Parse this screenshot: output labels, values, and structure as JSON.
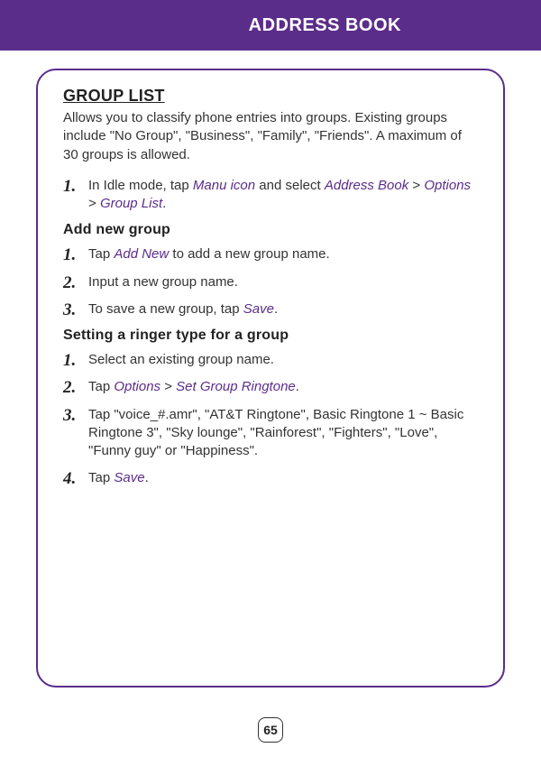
{
  "header": {
    "title": "ADDRESS BOOK"
  },
  "section": {
    "title": "GROUP LIST",
    "intro": "Allows you to classify phone entries into groups. Existing groups include \"No Group\", \"Business\", \"Family\", \"Friends\". A maximum of 30 groups is allowed."
  },
  "top_steps": {
    "items": [
      {
        "num": "1.",
        "prefix": "In Idle mode, tap ",
        "term1": "Manu icon",
        "mid1": " and select ",
        "term2": "Address Book",
        "gt1": " > ",
        "term3": "Options",
        "gt2": " > ",
        "term4": "Group List",
        "suffix": "."
      }
    ]
  },
  "add_new": {
    "heading": "Add new group",
    "items": [
      {
        "num": "1.",
        "prefix": "Tap ",
        "term1": "Add New",
        "suffix": " to add a new group name."
      },
      {
        "num": "2.",
        "text": "Input a new group name."
      },
      {
        "num": "3.",
        "prefix": "To save a new group, tap ",
        "term1": "Save",
        "suffix": "."
      }
    ]
  },
  "ringer": {
    "heading": "Setting a ringer type for a group",
    "items": [
      {
        "num": "1.",
        "text": "Select an existing group name."
      },
      {
        "num": "2.",
        "prefix": "Tap ",
        "term1": "Options",
        "gt1": " > ",
        "term2": "Set Group Ringtone",
        "suffix": "."
      },
      {
        "num": "3.",
        "text": "Tap \"voice_#.amr\", \"AT&T Ringtone\", Basic Ringtone 1 ~ Basic Ringtone 3\", \"Sky lounge\", \"Rainforest\", \"Fighters\", \"Love\", \"Funny guy\" or \"Happiness\"."
      },
      {
        "num": "4.",
        "prefix": "Tap ",
        "term1": "Save",
        "suffix": "."
      }
    ]
  },
  "page_number": "65"
}
